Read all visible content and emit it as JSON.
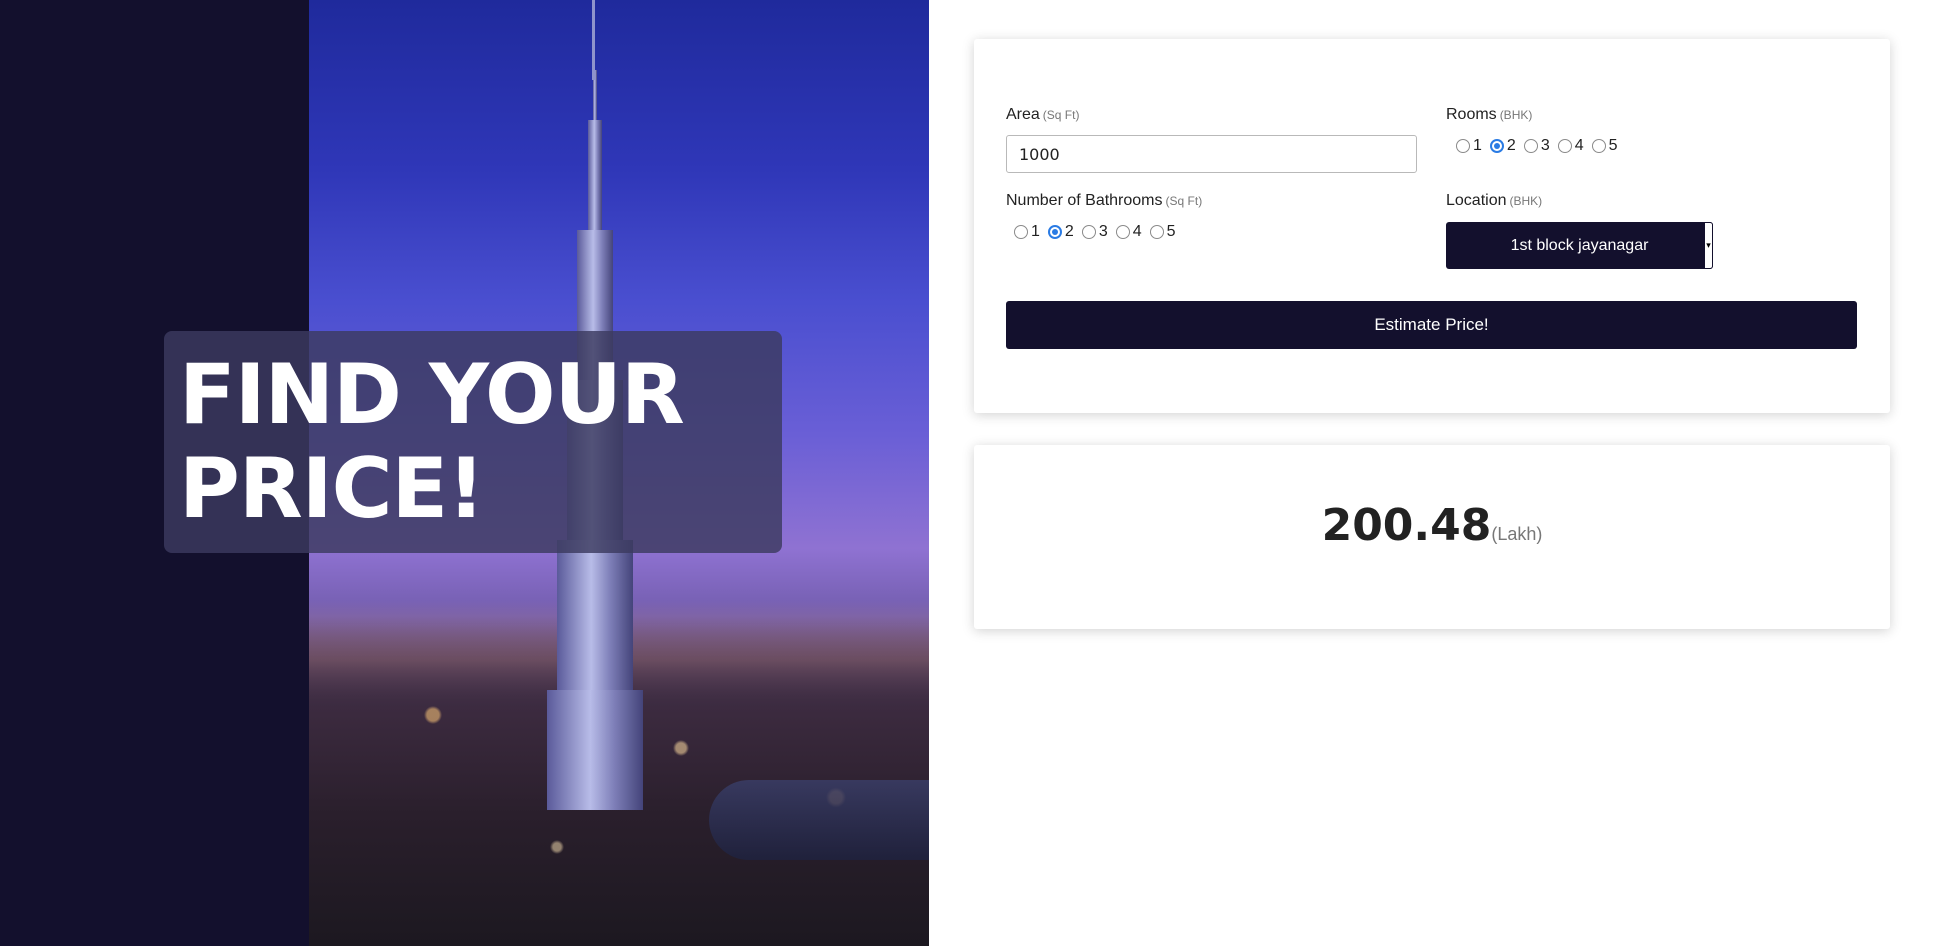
{
  "hero": {
    "title": "FIND YOUR PRICE!"
  },
  "form": {
    "area": {
      "label": "Area",
      "unit": "(Sq Ft)",
      "value": "1000"
    },
    "rooms": {
      "label": "Rooms",
      "unit": "(BHK)",
      "options": [
        "1",
        "2",
        "3",
        "4",
        "5"
      ],
      "selected": "2"
    },
    "bathrooms": {
      "label": "Number of Bathrooms",
      "unit": "(Sq Ft)",
      "options": [
        "1",
        "2",
        "3",
        "4",
        "5"
      ],
      "selected": "2"
    },
    "location": {
      "label": "Location",
      "unit": "(BHK)",
      "selected": "1st block jayanagar"
    },
    "estimate_button": "Estimate Price!"
  },
  "result": {
    "value": "200.48",
    "unit": "(Lakh)"
  },
  "colors": {
    "primary": "#13102d",
    "radio_accent": "#2a7be4"
  }
}
